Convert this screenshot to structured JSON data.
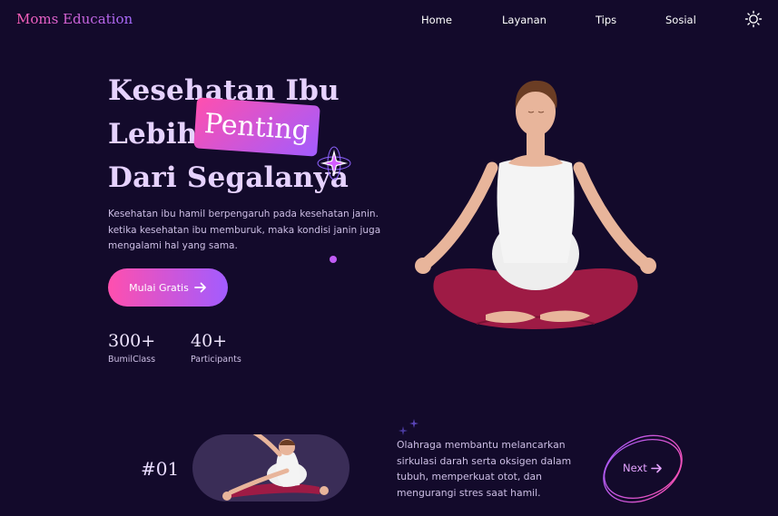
{
  "brand": {
    "logo": "Moms Education"
  },
  "nav": {
    "items": [
      "Home",
      "Layanan",
      "Tips",
      "Sosial"
    ],
    "theme_icon": "sun-icon"
  },
  "hero": {
    "title_line1": "Kesehatan Ibu",
    "title_line2": "Lebih",
    "highlight": "Penting",
    "title_line3": "Dari Segalanya",
    "description": "Kesehatan ibu hamil berpengaruh pada kesehatan janin. ketika kesehatan ibu memburuk, maka kondisi janin juga mengalami hal yang sama.",
    "cta_label": "Mulai Gratis",
    "cta_icon": "arrow-right-icon",
    "stats": [
      {
        "value": "300+",
        "label": "BumilClass"
      },
      {
        "value": "40+",
        "label": "Participants"
      }
    ]
  },
  "tip": {
    "number": "#01",
    "text": "Olahraga membantu melancarkan sirkulasi darah serta oksigen dalam tubuh, memperkuat otot, dan mengurangi stres saat hamil.",
    "next_label": "Next",
    "next_icon": "arrow-right-icon"
  },
  "colors": {
    "background": "#130a2b",
    "accent_pink": "#ff4fae",
    "accent_purple": "#a25cff",
    "legging": "#9e1b45"
  }
}
